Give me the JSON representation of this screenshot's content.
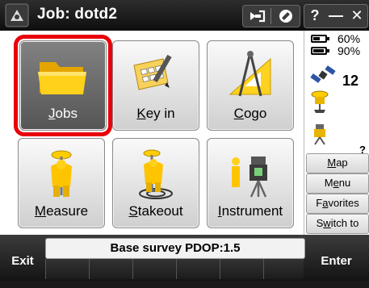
{
  "titlebar": {
    "title": "Job: dotd2",
    "buttons": [
      "back-arrow-icon",
      "no-entry-icon"
    ],
    "window_buttons": [
      "?",
      "—",
      "✕"
    ]
  },
  "menu": {
    "tiles": [
      {
        "label_ul": "J",
        "label_rest": "obs",
        "icon": "folder-icon",
        "selected": true
      },
      {
        "label_ul": "K",
        "label_rest": "ey in",
        "icon": "keyboard-sheet-icon",
        "selected": false
      },
      {
        "label_ul": "C",
        "label_rest": "ogo",
        "icon": "compass-icon",
        "selected": false
      },
      {
        "label_ul": "M",
        "label_rest": "easure",
        "icon": "surveyor-icon",
        "selected": false
      },
      {
        "label_ul": "S",
        "label_rest": "takeout",
        "icon": "stakeout-icon",
        "selected": false
      },
      {
        "label_ul": "I",
        "label_rest": "nstrument",
        "icon": "instrument-icon",
        "selected": false
      }
    ]
  },
  "status_panel": {
    "battery_1": "60%",
    "battery_2": "90%",
    "battery_1_level": 0.6,
    "battery_2_level": 0.9,
    "satellites": "12",
    "unknown": "?",
    "buttons": [
      {
        "pre": "",
        "ul": "M",
        "post": "ap"
      },
      {
        "pre": "M",
        "ul": "e",
        "post": "nu"
      },
      {
        "pre": "F",
        "ul": "a",
        "post": "vorites"
      },
      {
        "pre": "S",
        "ul": "w",
        "post": "itch to"
      }
    ]
  },
  "footer": {
    "exit_label": "Exit",
    "enter_label": "Enter",
    "status_text": "Base survey  PDOP:1.5"
  },
  "colors": {
    "selection": "#e8000b",
    "accent": "#f5c400"
  }
}
